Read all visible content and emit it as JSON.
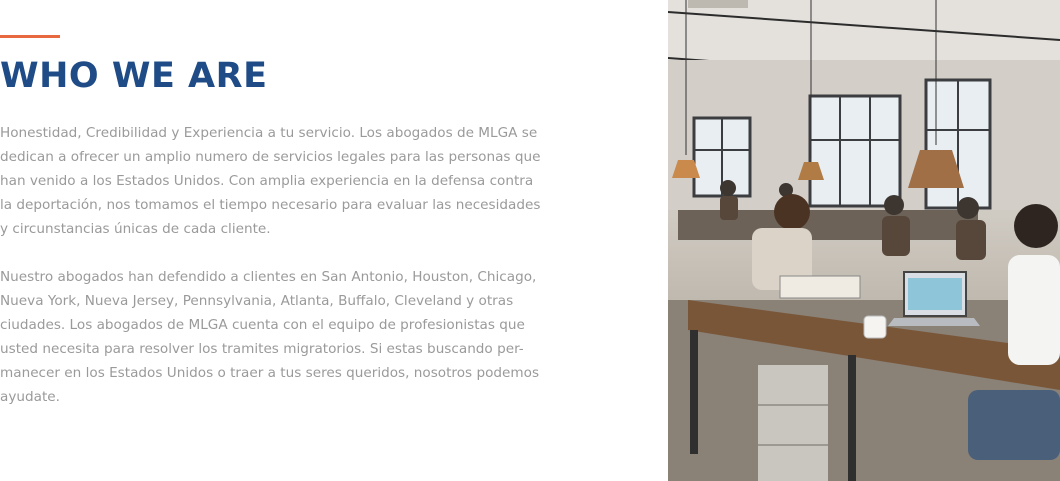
{
  "section": {
    "title": "WHO WE ARE",
    "paragraph1_lines": [
      "Honestidad, Credibilidad y Experiencia a tu servicio. Los abogados de MLGA se",
      "dedican a ofrecer un amplio numero de servicios legales para las personas que",
      "han venido a los Estados Unidos. Con amplia experiencia en la defensa contra",
      "la deportación, nos tomamos el tiempo necesario para evaluar las necesidades",
      "y circunstancias únicas de cada cliente."
    ],
    "paragraph2_lines": [
      "Nuestro abogados han defendido a clientes en San Antonio, Houston, Chicago,",
      "Nueva York, Nueva Jersey, Pennsylvania,  Atlanta, Buffalo, Cleveland y otras",
      "ciudades.  Los abogados de MLGA cuenta con el equipo de profesionistas que",
      "usted necesita para resolver los tramites migratorios. Si estas buscando per-",
      "manecer en los Estados Unidos o traer a tus seres queridos, nosotros podemos",
      "ayudate."
    ]
  },
  "colors": {
    "accent": "#e8683f",
    "title": "#1f4c86",
    "body_text": "#9a9a9a"
  },
  "image": {
    "subject": "office-workspace-photo"
  }
}
